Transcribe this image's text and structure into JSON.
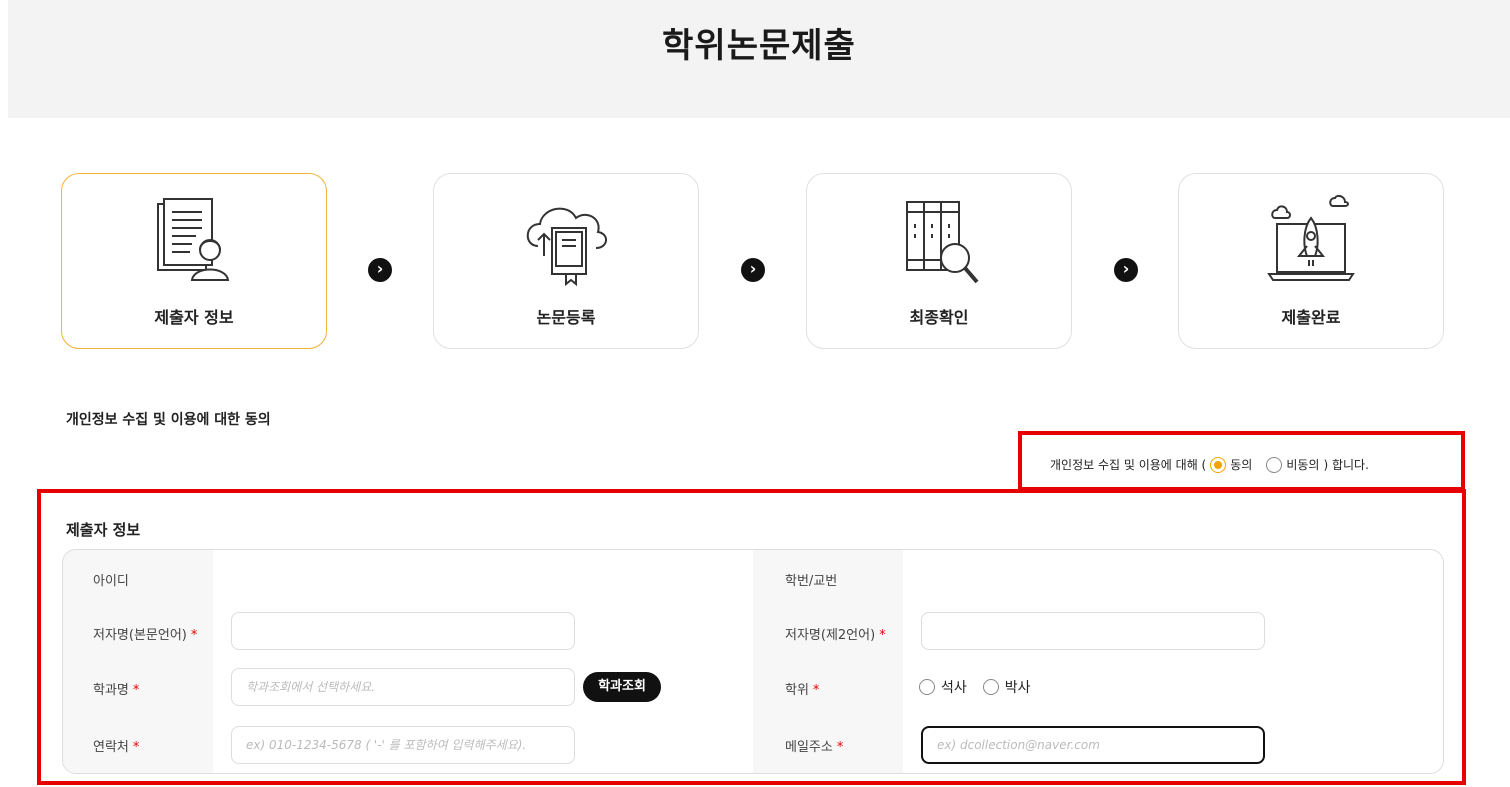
{
  "header": {
    "title": "학위논문제출"
  },
  "steps": [
    {
      "label": "제출자 정보",
      "icon": "document-person-icon"
    },
    {
      "label": "논문등록",
      "icon": "cloud-book-icon"
    },
    {
      "label": "최종확인",
      "icon": "binder-search-icon"
    },
    {
      "label": "제출완료",
      "icon": "rocket-laptop-icon"
    }
  ],
  "step_arrow": "›",
  "consent": {
    "title": "개인정보 수집 및 이용에 대한 동의",
    "prefix": "개인정보 수집 및 이용에 대해 (",
    "agree": "동의",
    "disagree": "비동의",
    "suffix": ") 합니다.",
    "selected": "agree"
  },
  "submitter": {
    "title": "제출자 정보",
    "id_label": "아이디",
    "student_no_label": "학번/교번",
    "author_main_label": "저자명(본문언어)",
    "author_second_label": "저자명(제2언어)",
    "dept_label": "학과명",
    "dept_placeholder": "학과조회에서 선택하세요.",
    "dept_button": "학과조회",
    "degree_label": "학위",
    "degree_options": [
      "석사",
      "박사"
    ],
    "contact_label": "연락처",
    "contact_placeholder": "ex) 010-1234-5678 ( '-' 를 포함하여 입력해주세요).",
    "email_label": "메일주소",
    "email_placeholder": "ex) dcollection@naver.com",
    "required_mark": "*"
  },
  "colors": {
    "accent": "#f0b43a",
    "highlight": "#e60000"
  }
}
